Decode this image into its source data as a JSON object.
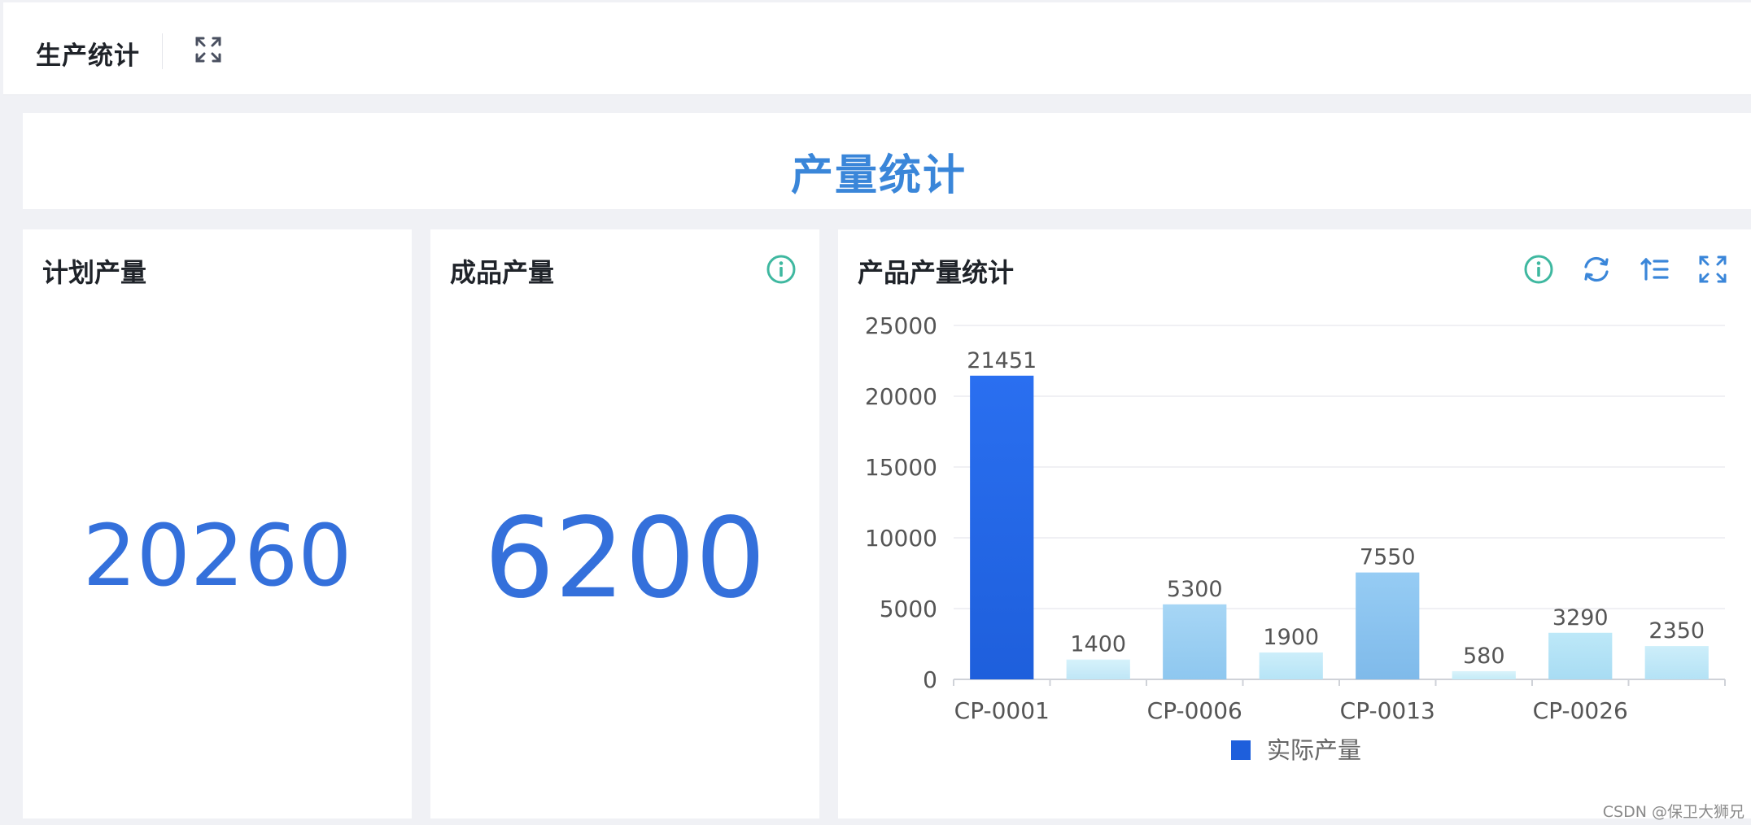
{
  "header": {
    "title": "生产统计",
    "expand_icon": "expand-icon"
  },
  "banner": {
    "title": "产量统计"
  },
  "cards": {
    "planned": {
      "title": "计划产量",
      "value": "20260"
    },
    "finished": {
      "title": "成品产量",
      "value": "6200",
      "info_icon": "info-icon"
    },
    "product": {
      "title": "产品产量统计",
      "toolbar_icons": [
        "info-icon",
        "refresh-icon",
        "sort-icon",
        "expand-icon"
      ]
    }
  },
  "chart_data": {
    "type": "bar",
    "title": "产品产量统计",
    "categories": [
      "CP-0001",
      "",
      "CP-0006",
      "",
      "CP-0013",
      "",
      "CP-0026",
      ""
    ],
    "x_tick_labels": [
      "CP-0001",
      "CP-0006",
      "CP-0013",
      "CP-0026"
    ],
    "series": [
      {
        "name": "实际产量",
        "values": [
          21451,
          1400,
          5300,
          1900,
          7550,
          580,
          3290,
          2350
        ]
      }
    ],
    "y_ticks": [
      0,
      5000,
      10000,
      15000,
      20000,
      25000
    ],
    "ylim": [
      0,
      25000
    ],
    "grid": true,
    "legend_position": "bottom",
    "colors": {
      "bars": [
        [
          "#2a6ff0",
          "#1e5fdc"
        ],
        [
          "#d6f2fb",
          "#bfe6f6"
        ],
        [
          "#a7d6f5",
          "#8ec7ef"
        ],
        [
          "#cdeefa",
          "#b6e4f6"
        ],
        [
          "#96ccf4",
          "#7fbaea"
        ],
        [
          "#d9f3fb",
          "#c4ebf7"
        ],
        [
          "#bde8f8",
          "#a8dcf3"
        ],
        [
          "#cdeefa",
          "#b4e2f5"
        ]
      ],
      "legend_swatch": "#1e5fdc"
    }
  },
  "watermark": "CSDN @保卫大狮兄",
  "colors": {
    "accent": "#3a86d9",
    "number": "#3470db",
    "icon_teal": "#3fb8a0"
  }
}
